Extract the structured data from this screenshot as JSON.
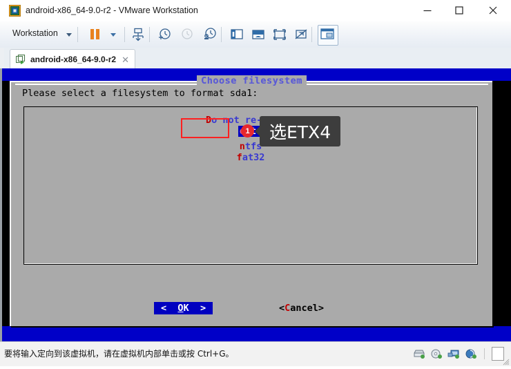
{
  "window": {
    "title": "android-x86_64-9.0-r2 - VMware Workstation",
    "app_icon": "vmware-logo-icon",
    "minimize_label": "—",
    "maximize_label": "□",
    "close_label": "✕"
  },
  "toolbar": {
    "menu_label": "Workstation",
    "items": [
      {
        "name": "suspend-resume-button",
        "label": "Suspend"
      },
      {
        "name": "snapshot-button",
        "label": "Snapshot"
      },
      {
        "name": "take-snapshot-button",
        "label": "Take snapshot"
      },
      {
        "name": "revert-snapshot-button",
        "label": "Revert snapshot"
      },
      {
        "name": "snapshot-manager-button",
        "label": "Manage snapshots"
      },
      {
        "name": "show-library-button",
        "label": "Show library"
      },
      {
        "name": "show-thumbnails-button",
        "label": "Show thumbnail bar"
      },
      {
        "name": "fullscreen-button",
        "label": "Enter full screen"
      },
      {
        "name": "unity-mode-button",
        "label": "Unity mode"
      },
      {
        "name": "console-view-button",
        "label": "Console view"
      }
    ]
  },
  "tab": {
    "label": "android-x86_64-9.0-r2",
    "close_label": "✕",
    "icon": "vm-tab-icon"
  },
  "dialog": {
    "title": "Choose filesystem",
    "prompt": "Please select a filesystem to format sda1:",
    "items": [
      {
        "hotkey": "D",
        "rest": "o not re-",
        "hotkey2": "f",
        "rest2": "ormat",
        "full": "Do not re-format",
        "selected": false
      },
      {
        "hotkey": "e",
        "rest": "xt4",
        "full": "ext4",
        "selected": true
      },
      {
        "hotkey": "n",
        "rest": "tfs",
        "full": "ntfs",
        "selected": false
      },
      {
        "hotkey": "f",
        "rest": "at32",
        "full": "fat32",
        "selected": false
      }
    ],
    "buttons": {
      "ok": {
        "left": "<",
        "pre": " ",
        "hotkey": "O",
        "rest": "K",
        "post": " ",
        "right": ">",
        "full": "< OK >"
      },
      "cancel": {
        "open": "<",
        "hotkey": "C",
        "rest": "ancel",
        "close": ">",
        "full": "<Cancel>"
      }
    }
  },
  "annotation": {
    "badge": "1",
    "tooltip": "选ETX4",
    "highlight_color": "#ff2020",
    "badge_color": "#e8282d",
    "tooltip_bg": "#3d3d3d"
  },
  "statusbar": {
    "message": "要将输入定向到该虚拟机，请在虚拟机内部单击或按 Ctrl+G。",
    "devices": [
      {
        "name": "hard-disk-icon",
        "label": "Hard Disk"
      },
      {
        "name": "cd-dvd-icon",
        "label": "CD/DVD"
      },
      {
        "name": "network-adapter-icon",
        "label": "Network Adapter"
      },
      {
        "name": "sound-card-icon",
        "label": "Sound Card"
      },
      {
        "name": "message-log-icon",
        "label": "Message Log"
      }
    ]
  },
  "colors": {
    "vm_blue": "#0000c8",
    "dialog_gray": "#aaaaaa",
    "select_blue": "#0000c0",
    "item_blue": "#3a3ad0",
    "hotkey_red": "#c00000",
    "title_violet": "#5b5bd6"
  }
}
